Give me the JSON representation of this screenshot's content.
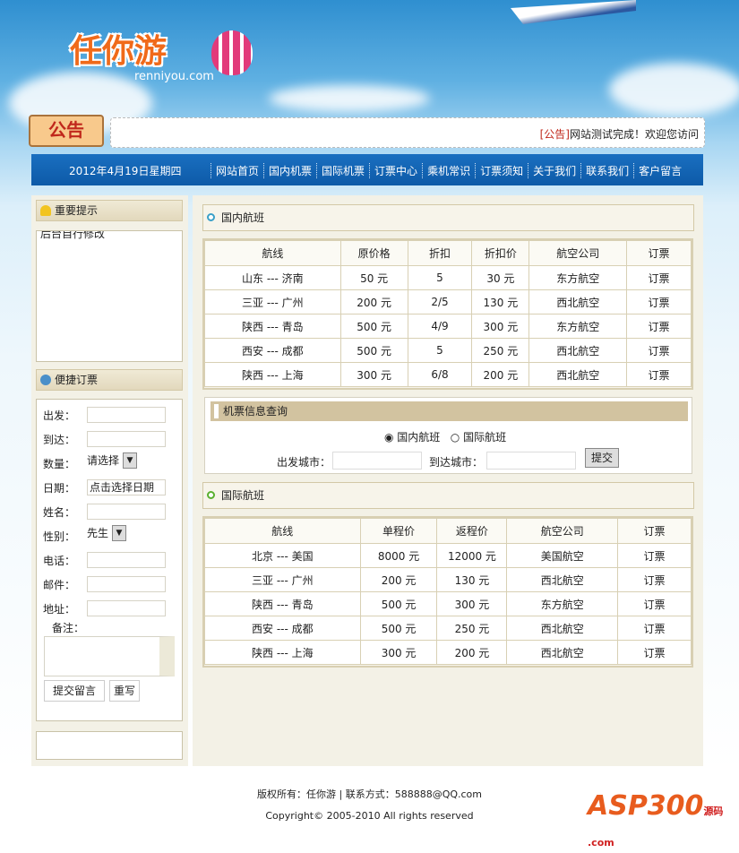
{
  "header": {
    "logo": "任你游",
    "logo_sub": "renniyou.com",
    "notice_label": "公告",
    "notice_tag": "[公告]",
    "notice_text": "网站测试完成！欢迎您访问"
  },
  "navbar": {
    "date": "2012年4月19日星期四",
    "items": [
      "网站首页",
      "国内机票",
      "国际机票",
      "订票中心",
      "乘机常识",
      "订票须知",
      "关于我们",
      "联系我们",
      "客户留言"
    ]
  },
  "sidebar": {
    "tips_title": "重要提示",
    "tips_text": "后台自行修改",
    "booking_title": "便捷订票",
    "fields": {
      "from": "出发：",
      "to": "到达：",
      "qty": "数量：",
      "qty_value": "请选择",
      "date": "日期：",
      "date_value": "点击选择日期",
      "name": "姓名：",
      "gender": "性别：",
      "gender_value": "先生",
      "phone": "电话：",
      "mail": "邮件：",
      "addr": "地址：",
      "note": "备注："
    },
    "submit": "提交留言",
    "reset": "重写"
  },
  "domestic": {
    "title": "国内航班",
    "headers": [
      "航线",
      "原价格",
      "折扣",
      "折扣价",
      "航空公司",
      "订票"
    ],
    "rows": [
      [
        "山东 --- 济南",
        "50 元",
        "5",
        "30 元",
        "东方航空",
        "订票"
      ],
      [
        "三亚 --- 广州",
        "200 元",
        "2/5",
        "130 元",
        "西北航空",
        "订票"
      ],
      [
        "陕西 --- 青岛",
        "500 元",
        "4/9",
        "300 元",
        "东方航空",
        "订票"
      ],
      [
        "西安 --- 成都",
        "500 元",
        "5",
        "250 元",
        "西北航空",
        "订票"
      ],
      [
        "陕西 --- 上海",
        "300 元",
        "6/8",
        "200 元",
        "西北航空",
        "订票"
      ]
    ]
  },
  "query": {
    "title": "机票信息查询",
    "radio_domestic": "国内航班",
    "radio_intl": "国际航班",
    "from_city": "出发城市：",
    "to_city": "到达城市：",
    "submit": "提交"
  },
  "international": {
    "title": "国际航班",
    "headers": [
      "航线",
      "单程价",
      "返程价",
      "航空公司",
      "订票"
    ],
    "rows": [
      [
        "北京 --- 美国",
        "8000 元",
        "12000 元",
        "美国航空",
        "订票"
      ],
      [
        "三亚 --- 广州",
        "200 元",
        "130 元",
        "西北航空",
        "订票"
      ],
      [
        "陕西 --- 青岛",
        "500 元",
        "300 元",
        "东方航空",
        "订票"
      ],
      [
        "西安 --- 成都",
        "500 元",
        "250 元",
        "西北航空",
        "订票"
      ],
      [
        "陕西 --- 上海",
        "300 元",
        "200 元",
        "西北航空",
        "订票"
      ]
    ]
  },
  "footer": {
    "line1": "版权所有：任你游 | 联系方式：588888@QQ.com",
    "line2": "Copyright© 2005-2010 All rights reserved",
    "badge": "ASP300",
    "badge_sub": "源码 .com"
  }
}
